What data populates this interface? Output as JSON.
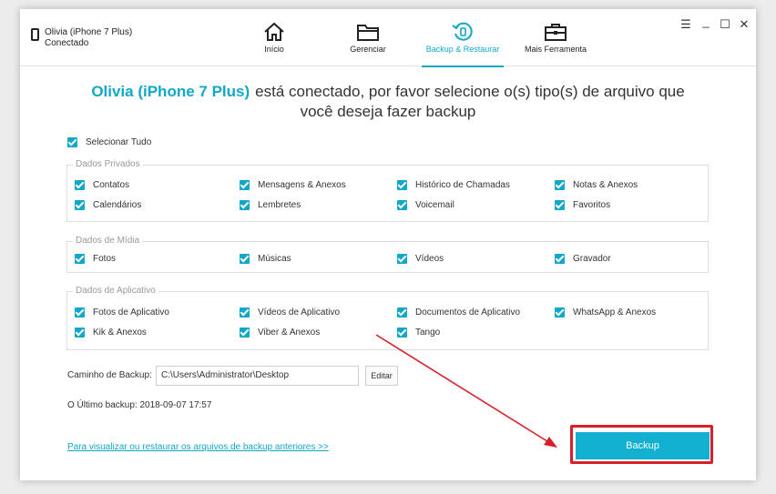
{
  "device": {
    "name": "Olivia (iPhone 7 Plus)",
    "status": "Conectado"
  },
  "nav": [
    {
      "label": "Início",
      "icon": "home-icon"
    },
    {
      "label": "Gerenciar",
      "icon": "folder-icon"
    },
    {
      "label": "Backup & Restaurar",
      "icon": "backup-restore-icon",
      "active": true
    },
    {
      "label": "Mais Ferramenta",
      "icon": "toolbox-icon"
    }
  ],
  "window_controls": {
    "menu": "☰",
    "minimize": "_",
    "maximize": "☐",
    "close": "✕"
  },
  "title": {
    "device": "Olivia (iPhone 7 Plus)",
    "line1": "está conectado, por favor selecione o(s) tipo(s) de arquivo que",
    "line2": "você deseja fazer backup"
  },
  "select_all": "Selecionar Tudo",
  "groups": {
    "private": {
      "legend": "Dados Privados",
      "items": [
        "Contatos",
        "Mensagens & Anexos",
        "Histórico de Chamadas",
        "Notas & Anexos",
        "Calendários",
        "Lembretes",
        "Voicemail",
        "Favoritos"
      ]
    },
    "media": {
      "legend": "Dados de Mídia",
      "items": [
        "Fotos",
        "Músicas",
        "Vídeos",
        "Gravador"
      ]
    },
    "app": {
      "legend": "Dados de Aplicativo",
      "items": [
        "Fotos de Aplicativo",
        "Vídeos de Aplicativo",
        "Documentos de Aplicativo",
        "WhatsApp & Anexos",
        "Kik & Anexos",
        "Viber & Anexos",
        "Tango"
      ]
    }
  },
  "path": {
    "label": "Caminho de Backup:",
    "value": "C:\\Users\\Administrator\\Desktop",
    "edit": "Editar"
  },
  "last_backup": "O Último backup: 2018-09-07 17:57",
  "view_link": "Para visualizar ou restaurar os arquivos de backup anteriores >>",
  "backup_button": "Backup",
  "colors": {
    "accent": "#11a7c8",
    "highlight": "#d8202a"
  }
}
